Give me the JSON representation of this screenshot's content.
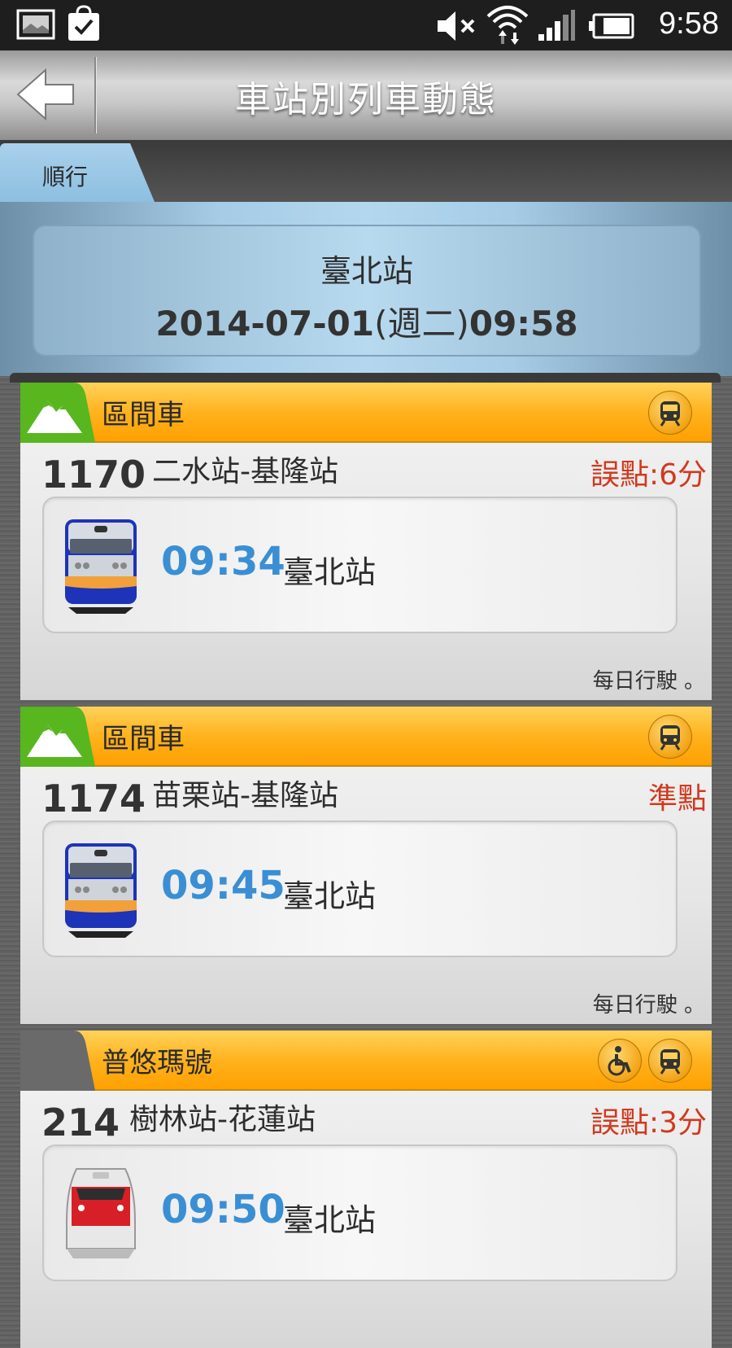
{
  "status_bar": {
    "time": "9:58"
  },
  "header": {
    "title": "車站別列車動態"
  },
  "tabs": [
    {
      "label": "順行"
    }
  ],
  "station": {
    "name": "臺北站",
    "date": "2014-07-01",
    "weekday": "(週二)",
    "time": "09:58"
  },
  "trains": [
    {
      "type": "區間車",
      "number": "1170",
      "route": "二水站-基隆站",
      "status": "誤點:6分",
      "time": "09:34",
      "station": "臺北站",
      "note": "每日行駛 。"
    },
    {
      "type": "區間車",
      "number": "1174",
      "route": "苗栗站-基隆站",
      "status": "準點",
      "time": "09:45",
      "station": "臺北站",
      "note": "每日行駛 。"
    },
    {
      "type": "普悠瑪號",
      "number": "214",
      "route": "樹林站-花蓮站",
      "status": "誤點:3分",
      "time": "09:50",
      "station": "臺北站"
    }
  ],
  "colors": {
    "accent_orange": "#ffb21d",
    "time_blue": "#3a8fd4",
    "status_red": "#d03a1f",
    "tab_blue": "#a9d1ec"
  }
}
